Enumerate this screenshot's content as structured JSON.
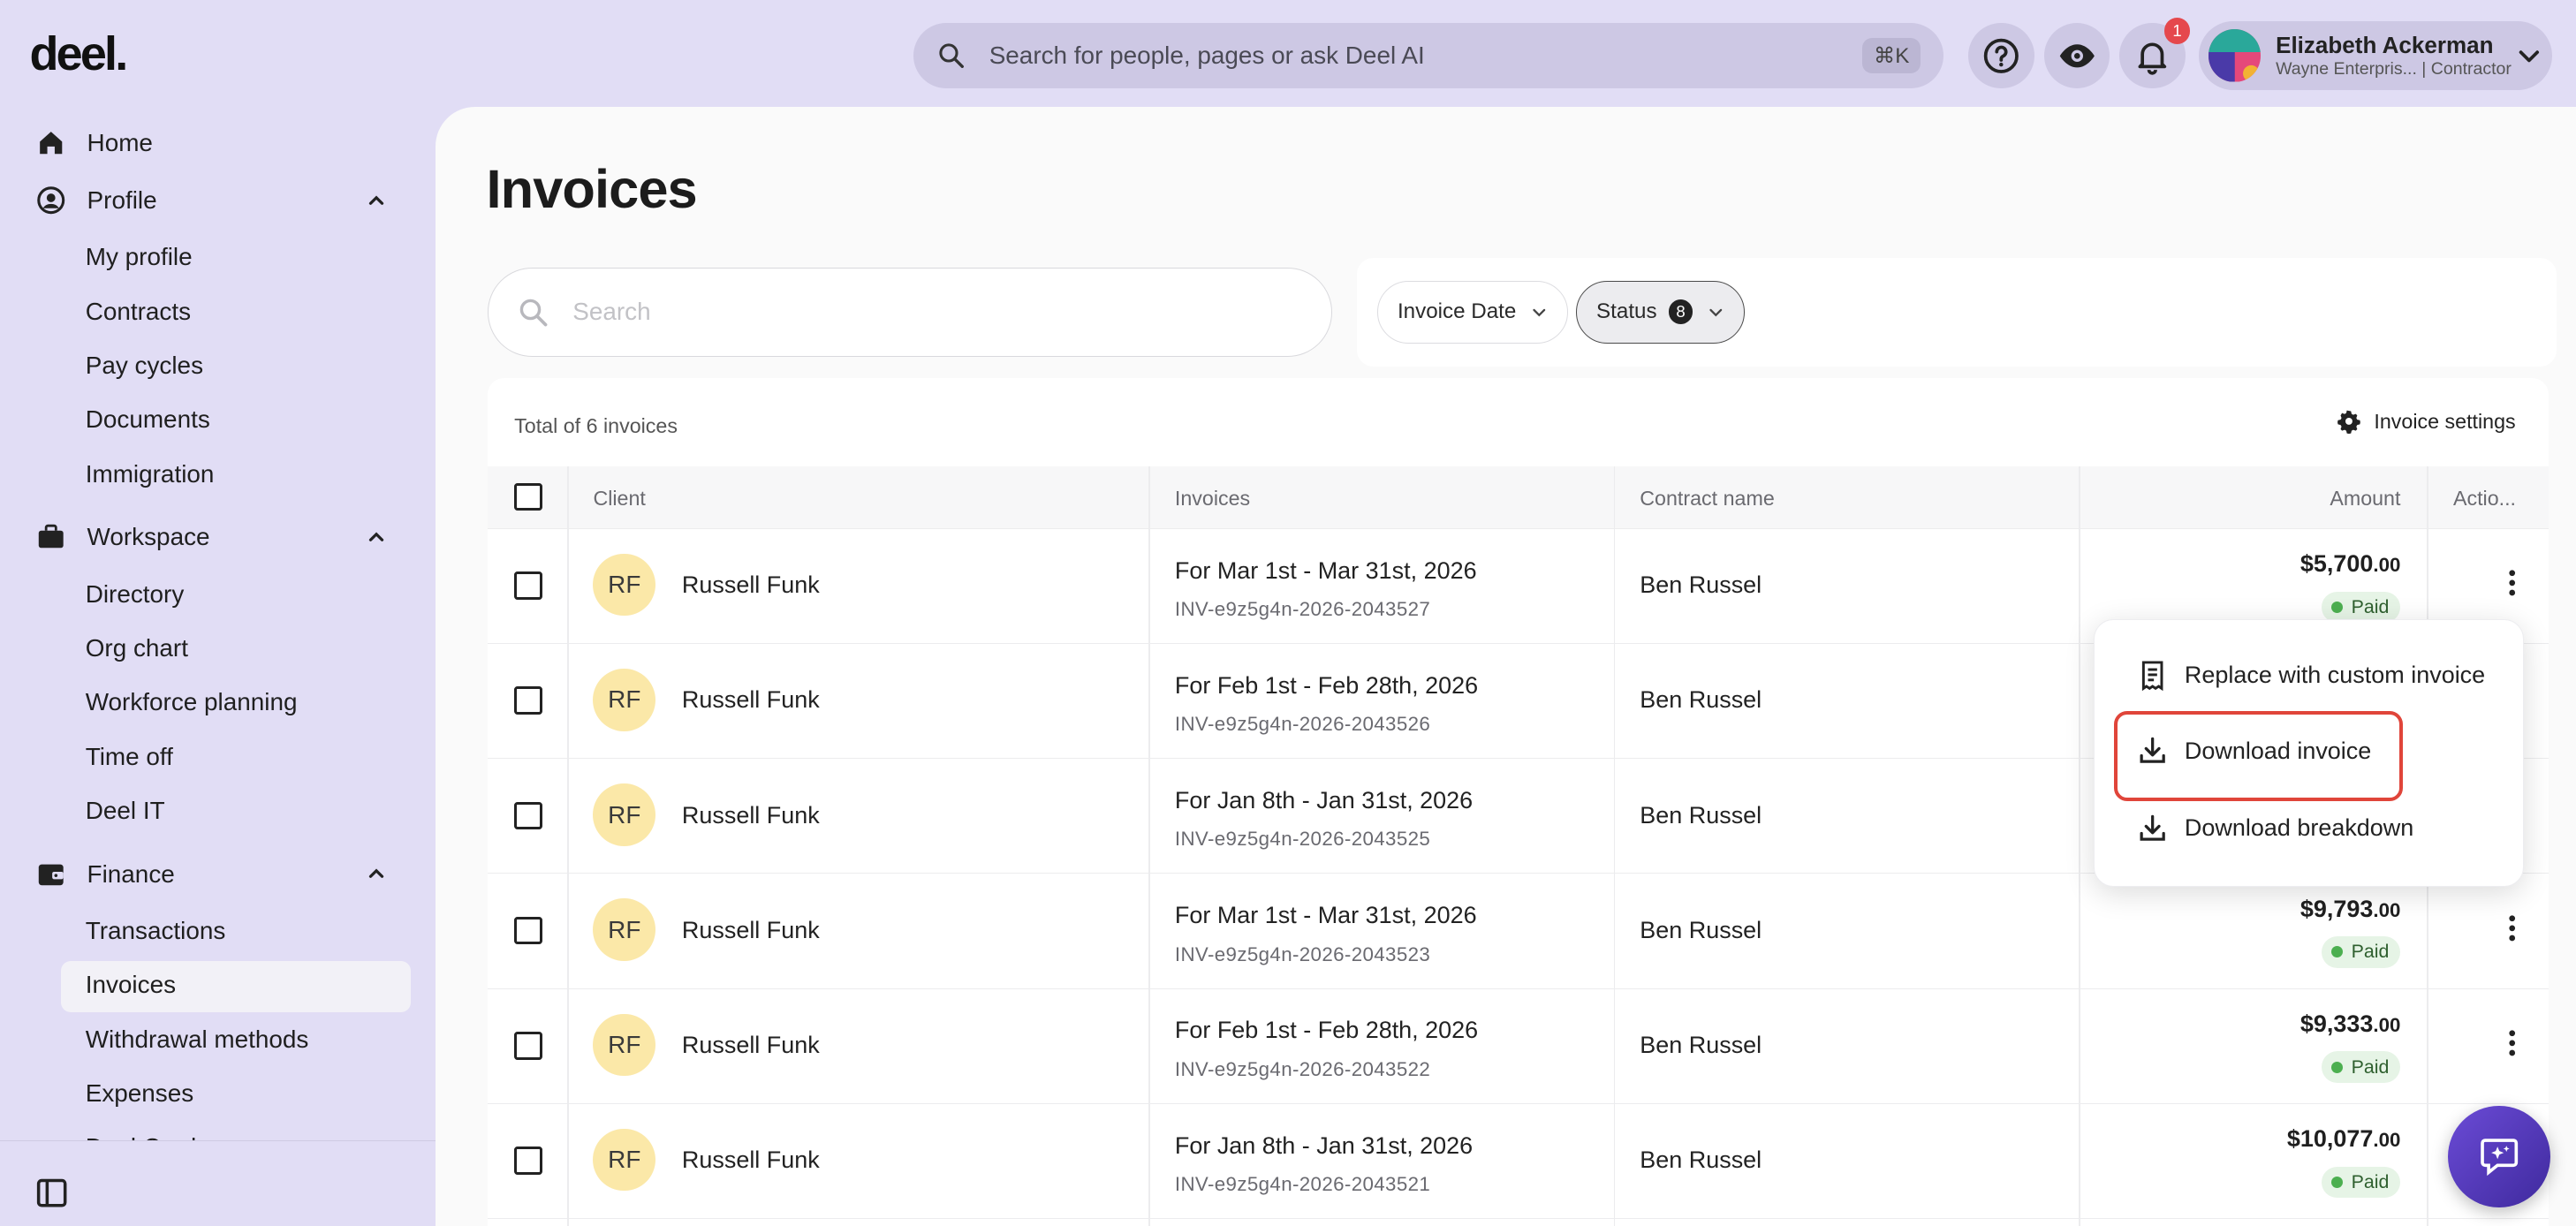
{
  "brand": {
    "logo_text": "deel."
  },
  "topbar": {
    "search_placeholder": "Search for people, pages or ask Deel AI",
    "search_shortcut": "⌘K",
    "notification_count": "1",
    "user": {
      "name": "Elizabeth Ackerman",
      "subtitle": "Wayne Enterpris... | Contractor"
    }
  },
  "sidebar": {
    "home": "Home",
    "profile": {
      "label": "Profile",
      "items": [
        "My profile",
        "Contracts",
        "Pay cycles",
        "Documents",
        "Immigration"
      ]
    },
    "workspace": {
      "label": "Workspace",
      "items": [
        "Directory",
        "Org chart",
        "Workforce planning",
        "Time off",
        "Deel IT"
      ]
    },
    "finance": {
      "label": "Finance",
      "items": [
        "Transactions",
        "Invoices",
        "Withdrawal methods",
        "Expenses",
        "Deel Card"
      ]
    },
    "active_item": "Invoices"
  },
  "main": {
    "title": "Invoices",
    "search_placeholder": "Search",
    "filters": {
      "invoice_date": "Invoice Date",
      "status": "Status",
      "status_count": "8"
    },
    "total_label": "Total of 6 invoices",
    "settings_label": "Invoice settings",
    "columns": {
      "client": "Client",
      "invoices": "Invoices",
      "contract": "Contract name",
      "amount": "Amount",
      "actions": "Actio..."
    },
    "rows": [
      {
        "initials": "RF",
        "client": "Russell Funk",
        "period": "For Mar 1st - Mar 31st, 2026",
        "number": "INV-e9z5g4n-2026-2043527",
        "contract": "Ben Russel",
        "amount_main": "$5,700",
        "amount_cents": ".00",
        "status": "Paid"
      },
      {
        "initials": "RF",
        "client": "Russell Funk",
        "period": "For Feb 1st - Feb 28th, 2026",
        "number": "INV-e9z5g4n-2026-2043526",
        "contract": "Ben Russel",
        "amount_main": "",
        "amount_cents": "",
        "status": ""
      },
      {
        "initials": "RF",
        "client": "Russell Funk",
        "period": "For Jan 8th - Jan 31st, 2026",
        "number": "INV-e9z5g4n-2026-2043525",
        "contract": "Ben Russel",
        "amount_main": "",
        "amount_cents": "",
        "status": ""
      },
      {
        "initials": "RF",
        "client": "Russell Funk",
        "period": "For Mar 1st - Mar 31st, 2026",
        "number": "INV-e9z5g4n-2026-2043523",
        "contract": "Ben Russel",
        "amount_main": "$9,793",
        "amount_cents": ".00",
        "status": "Paid"
      },
      {
        "initials": "RF",
        "client": "Russell Funk",
        "period": "For Feb 1st - Feb 28th, 2026",
        "number": "INV-e9z5g4n-2026-2043522",
        "contract": "Ben Russel",
        "amount_main": "$9,333",
        "amount_cents": ".00",
        "status": "Paid"
      },
      {
        "initials": "RF",
        "client": "Russell Funk",
        "period": "For Jan 8th - Jan 31st, 2026",
        "number": "INV-e9z5g4n-2026-2043521",
        "contract": "Ben Russel",
        "amount_main": "$10,077",
        "amount_cents": ".00",
        "status": "Paid"
      }
    ]
  },
  "actions_menu": {
    "items": [
      "Replace with custom invoice",
      "Download invoice",
      "Download breakdown"
    ],
    "highlighted": "Download invoice"
  },
  "colors": {
    "background": "#e1ddf5",
    "avatar_fill": "#fbe8a8",
    "paid_dot": "#4caf50",
    "highlight": "#e0453a",
    "ai_button": "#5a3fc0"
  }
}
